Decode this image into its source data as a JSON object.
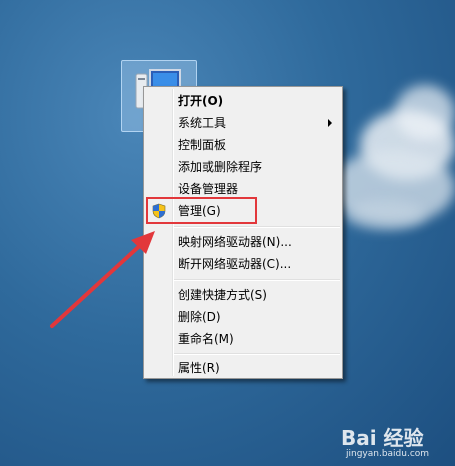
{
  "context_menu": {
    "items": [
      {
        "label": "打开(O)",
        "bold": true
      },
      {
        "label": "系统工具",
        "submenu": true
      },
      {
        "label": "控制面板"
      },
      {
        "label": "添加或删除程序"
      },
      {
        "label": "设备管理器"
      },
      {
        "label": "管理(G)",
        "icon": "uac-shield-icon",
        "highlighted": true
      },
      {
        "label": "映射网络驱动器(N)..."
      },
      {
        "label": "断开网络驱动器(C)..."
      },
      {
        "label": "创建快捷方式(S)"
      },
      {
        "label": "删除(D)"
      },
      {
        "label": "重命名(M)"
      },
      {
        "label": "属性(R)"
      }
    ]
  },
  "annotation": {
    "highlight_color": "#e2373b"
  },
  "watermark": {
    "logo": "Bai 经验",
    "url": "jingyan.baidu.com"
  }
}
